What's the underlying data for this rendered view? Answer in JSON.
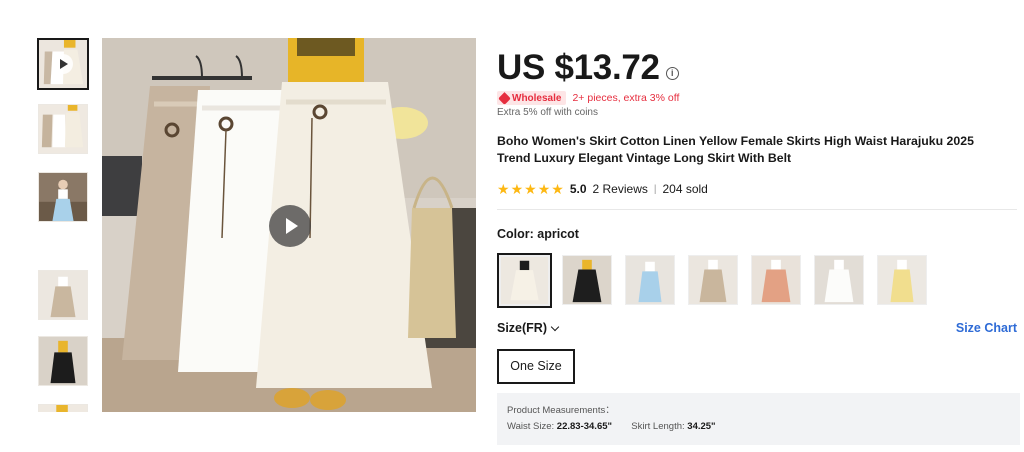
{
  "gallery": {
    "thumbnails": [
      {
        "name": "thumb-video",
        "kind": "video",
        "active": true
      },
      {
        "name": "thumb-2",
        "kind": "image"
      },
      {
        "name": "thumb-3",
        "kind": "image"
      },
      {
        "name": "thumb-4",
        "kind": "image"
      },
      {
        "name": "thumb-5",
        "kind": "image"
      },
      {
        "name": "thumb-6",
        "kind": "image"
      }
    ],
    "main_image": {
      "has_video": true,
      "play_icon": "play-icon"
    }
  },
  "product": {
    "price": "US $13.72",
    "price_info_icon": "info-icon",
    "wholesale_badge": "Wholesale",
    "wholesale_icon": "tag-icon",
    "wholesale_promo": "2+ pieces, extra 3% off",
    "coins_promo": "Extra 5% off with coins",
    "title": "Boho Women's Skirt Cotton Linen Yellow Female Skirts High Waist Harajuku 2025 Trend Luxury Elegant Vintage Long Skirt With Belt",
    "rating": {
      "stars": 5,
      "score": "5.0",
      "reviews": "2 Reviews",
      "separator": "|",
      "sold": "204 sold"
    },
    "color": {
      "label": "Color: ",
      "selected": "apricot",
      "swatch_count": 7
    },
    "size": {
      "label": "Size(FR)",
      "size_chart_link": "Size Chart",
      "options": [
        "One Size"
      ]
    },
    "measurements": {
      "heading": "Product Measurements：",
      "waist_label": "Waist Size: ",
      "waist_value": "22.83-34.65\"",
      "length_label": "Skirt Length: ",
      "length_value": "34.25\""
    }
  },
  "colors": {
    "price_text": "#191919",
    "promo_red": "#e62e3f",
    "badge_bg": "#fde5e6",
    "star": "#fdb813",
    "link_blue": "#2e6bd6",
    "measure_bg": "#f2f3f5"
  }
}
